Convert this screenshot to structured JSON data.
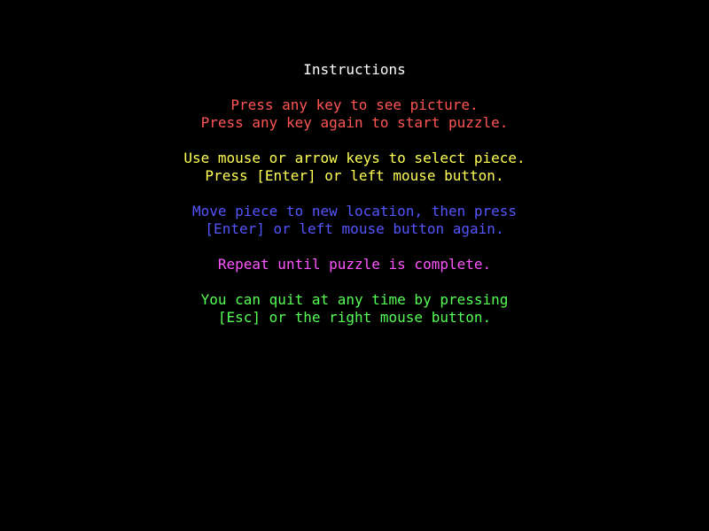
{
  "screen": {
    "title": "Instructions",
    "colors": {
      "background": "#000000",
      "title": "#ffffff",
      "step_picture": "#ff5555",
      "step_select": "#ffff55",
      "step_move": "#5555ff",
      "step_repeat": "#ff55ff",
      "step_quit": "#55ff55"
    },
    "sections": [
      {
        "lines": [
          "Press any key to see picture.",
          "Press any key again to start puzzle."
        ]
      },
      {
        "lines": [
          "Use mouse or arrow keys to select piece.",
          "Press [Enter] or left mouse button."
        ]
      },
      {
        "lines": [
          "Move piece to new location, then press",
          "[Enter] or left mouse button again."
        ]
      },
      {
        "lines": [
          "Repeat until puzzle is complete."
        ]
      },
      {
        "lines": [
          "You can quit at any time by pressing",
          "[Esc] or the right mouse button."
        ]
      }
    ]
  }
}
